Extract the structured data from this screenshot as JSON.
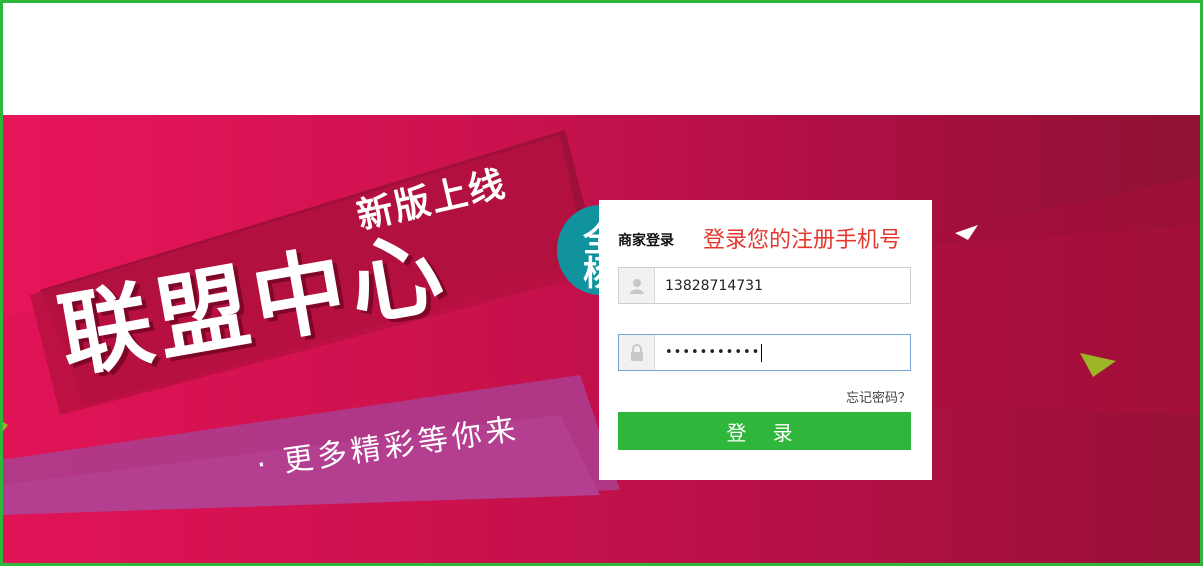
{
  "banner": {
    "slogan_small": "新版上线",
    "slogan_big": "联盟中心",
    "slogan_sub": "· 更多精彩等你来",
    "badge_text": "全 杨"
  },
  "login": {
    "title": "商家登录",
    "hint": "登录您的注册手机号",
    "phone_value": "13828714731",
    "password_value": "•••••••••••",
    "forgot_label": "忘记密码？",
    "submit_label": "登 录"
  },
  "colors": {
    "accent_green": "#2eb73a",
    "banner_pink": "#e8145a",
    "hint_red": "#e3382f"
  },
  "icons": {
    "user": "user-icon",
    "lock": "lock-icon"
  }
}
